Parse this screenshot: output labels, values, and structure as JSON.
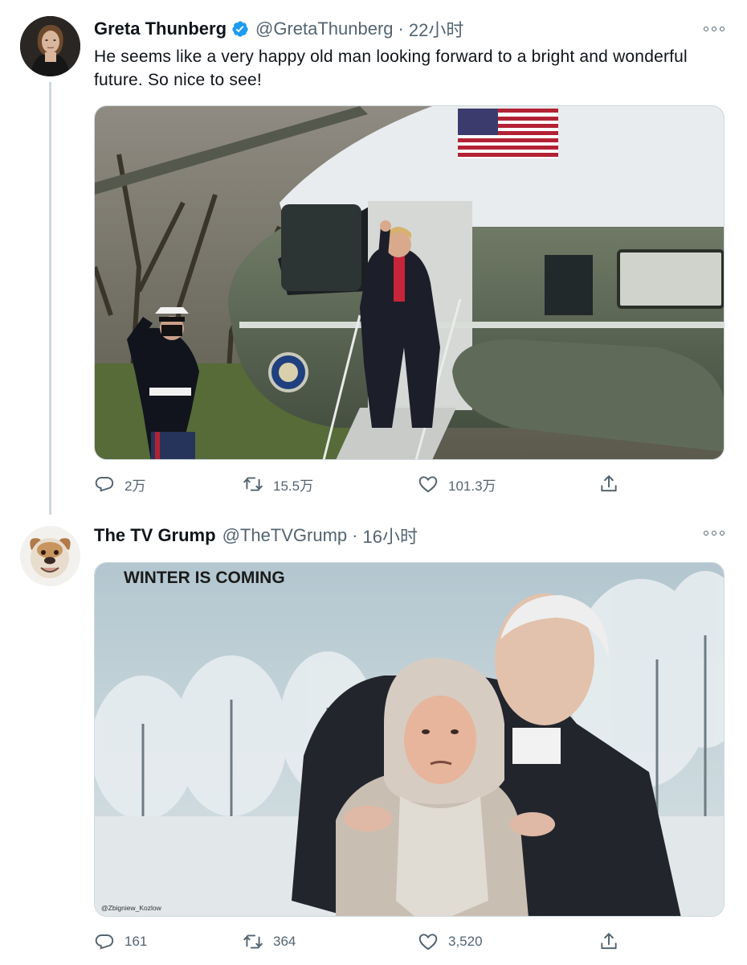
{
  "tweets": [
    {
      "author": {
        "name": "Greta Thunberg",
        "handle": "@GretaThunberg",
        "verified": true
      },
      "separator": "·",
      "time": "22小时",
      "text": "He seems like a very happy old man looking forward to a bright and wonderful future. So nice to see!",
      "counts": {
        "reply": "2万",
        "retweet": "15.5万",
        "like": "101.3万"
      }
    },
    {
      "author": {
        "name": "The TV Grump",
        "handle": "@TheTVGrump",
        "verified": false
      },
      "separator": "·",
      "time": "16小时",
      "media_caption": "WINTER IS COMING",
      "media_credit": "@Zbigniew_Kozlow",
      "counts": {
        "reply": "161",
        "retweet": "364",
        "like": "3,520"
      }
    }
  ],
  "colors": {
    "verified": "#1d9bf0",
    "secondary_text": "#536471",
    "thread_line": "#cfd9de"
  },
  "icons": [
    "reply-icon",
    "retweet-icon",
    "like-icon",
    "share-icon",
    "more-icon",
    "verified-badge-icon"
  ]
}
